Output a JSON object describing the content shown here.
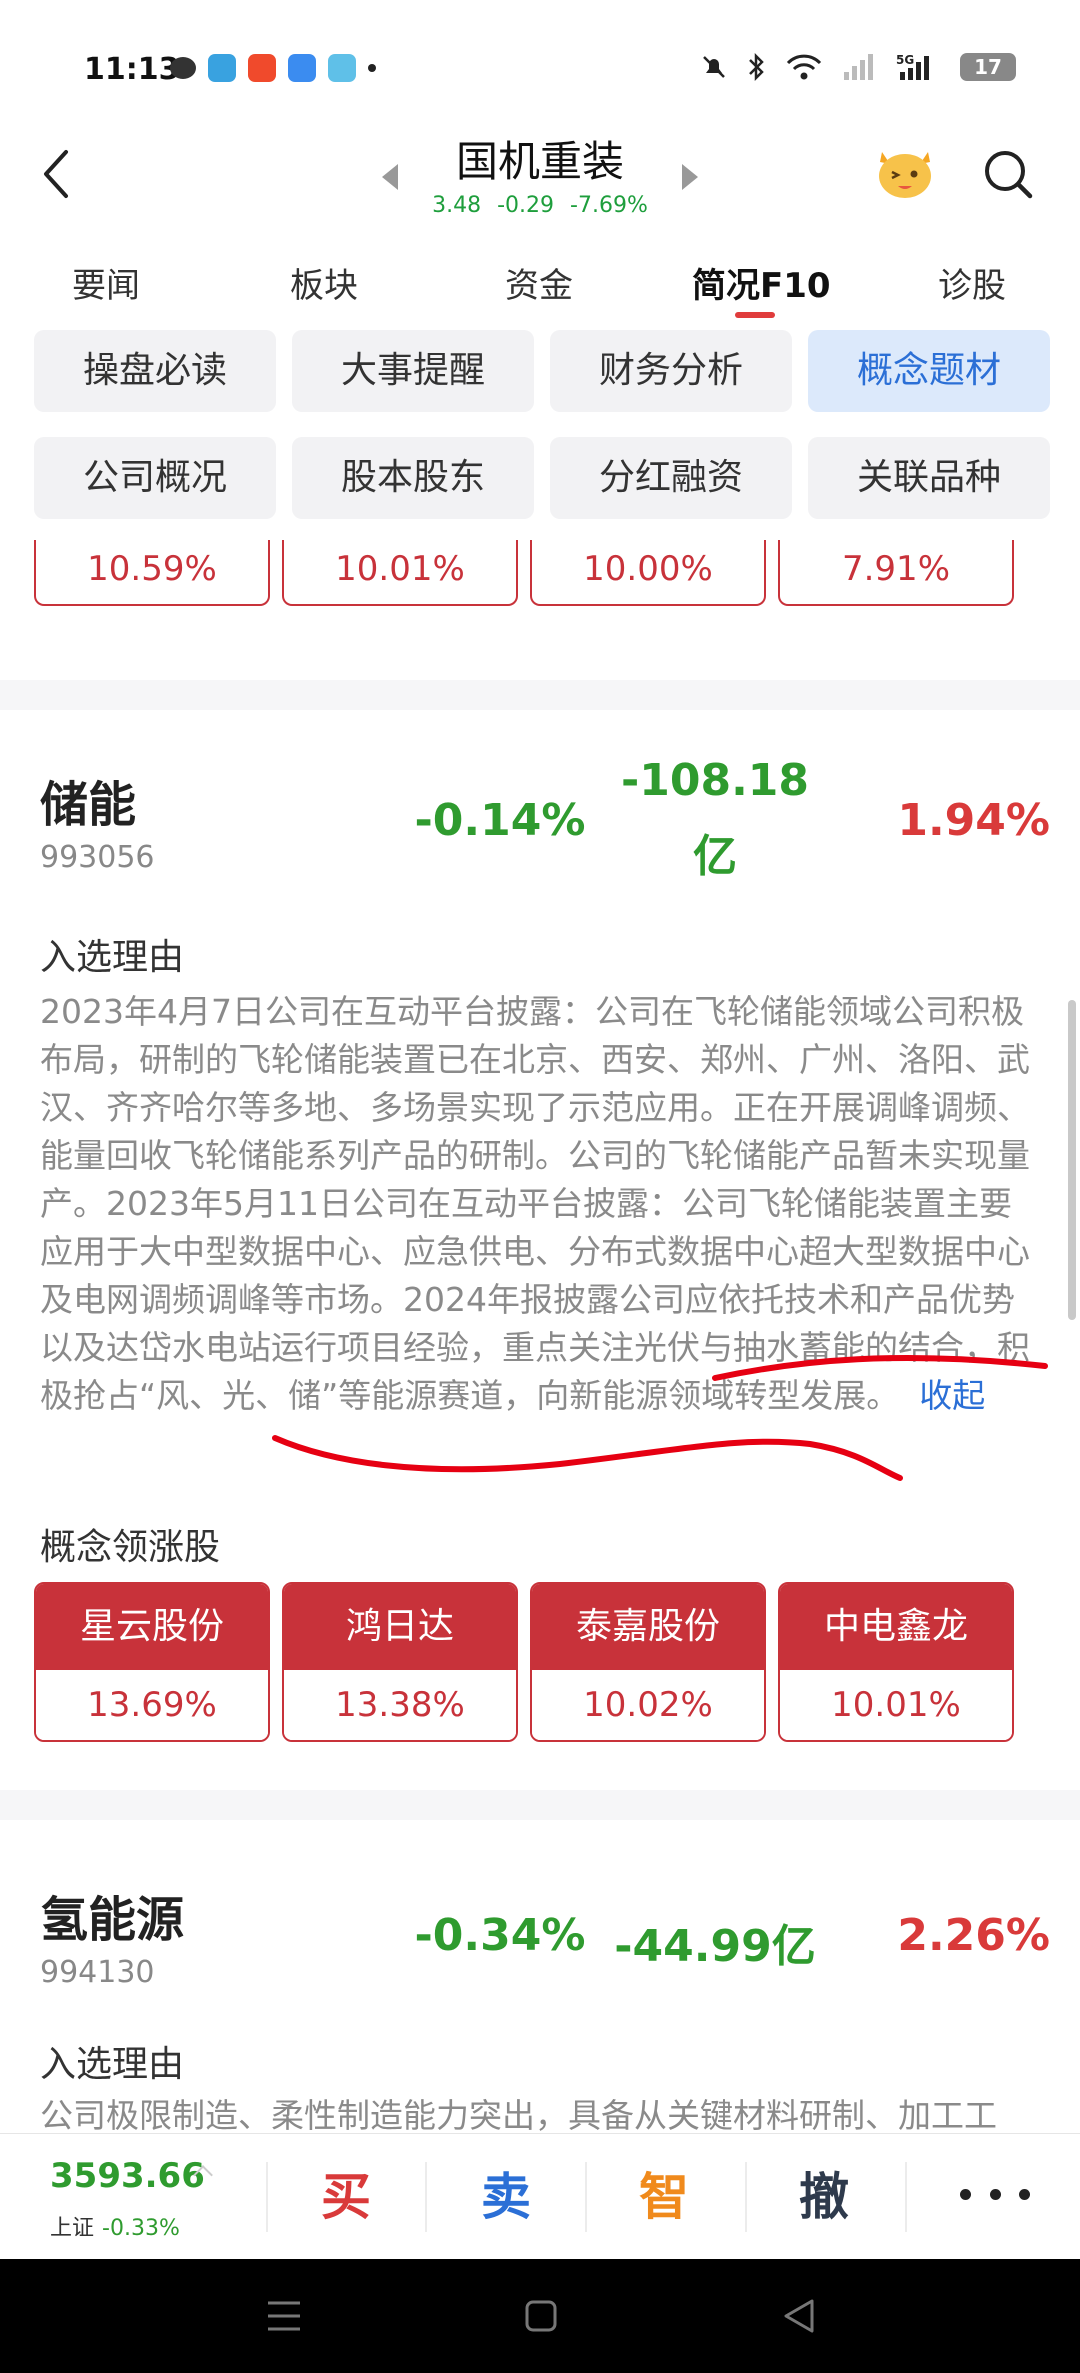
{
  "status_bar": {
    "time": "11:13",
    "battery": "17",
    "network": "5G"
  },
  "header": {
    "stock_name": "国机重装",
    "price": "3.48",
    "change": "-0.29",
    "change_pct": "-7.69%"
  },
  "main_tabs": [
    "要闻",
    "板块",
    "资金",
    "简况F10",
    "诊股"
  ],
  "sub_nav": [
    "操盘必读",
    "大事提醒",
    "财务分析",
    "概念题材",
    "公司概况",
    "股本股东",
    "分红融资",
    "关联品种"
  ],
  "top_partial_cards": [
    "10.59%",
    "10.01%",
    "10.00%",
    "7.91%"
  ],
  "concepts": [
    {
      "name": "储能",
      "code": "993056",
      "change_pct": "-0.14%",
      "net_flow_line1": "-108.18",
      "net_flow_line2": "亿",
      "ratio": "1.94%",
      "reason_label": "入选理由",
      "reason": "2023年4月7日公司在互动平台披露：公司在飞轮储能领域公司积极布局，研制的飞轮储能装置已在北京、西安、郑州、广州、洛阳、武汉、齐齐哈尔等多地、多场景实现了示范应用。正在开展调峰调频、能量回收飞轮储能系列产品的研制。公司的飞轮储能产品暂未实现量产。2023年5月11日公司在互动平台披露：公司飞轮储能装置主要应用于大中型数据中心、应急供电、分布式数据中心超大型数据中心及电网调频调峰等市场。2024年报披露公司应依托技术和产品优势以及达岱水电站运行项目经验，重点关注光伏与抽水蓄能的结合，积极抢占“风、光、储”等能源赛道，向新能源领域转型发展。",
      "collapse": "收起",
      "leaders_label": "概念领涨股",
      "leaders": [
        {
          "name": "星云股份",
          "pct": "13.69%"
        },
        {
          "name": "鸿日达",
          "pct": "13.38%"
        },
        {
          "name": "泰嘉股份",
          "pct": "10.02%"
        },
        {
          "name": "中电鑫龙",
          "pct": "10.01%"
        }
      ]
    },
    {
      "name": "氢能源",
      "code": "994130",
      "change_pct": "-0.34%",
      "net_flow": "-44.99亿",
      "ratio": "2.26%",
      "reason_label": "入选理由",
      "reason": "公司极限制造、柔性制造能力突出，具备从关键材料研制、加工工"
    }
  ],
  "trade_bar": {
    "index_value": "3593.66",
    "index_name": "上证",
    "index_change": "-0.33%",
    "buy": "买",
    "sell": "卖",
    "smart": "智",
    "cancel": "撤"
  }
}
